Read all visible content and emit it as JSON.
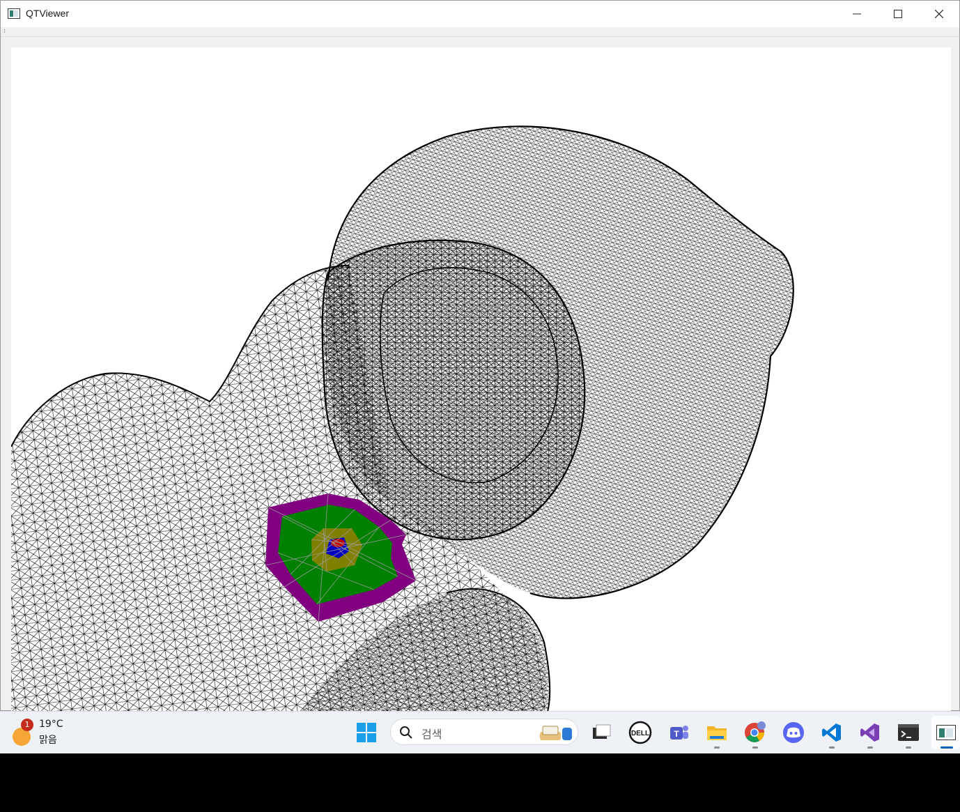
{
  "window": {
    "title": "QTViewer",
    "minimize_symbol": "—",
    "maximize_symbol": "☐",
    "close_symbol": "✕"
  },
  "viewport": {
    "background": "#ffffff",
    "wire_color": "#000000",
    "region_colors": {
      "outer": "#800080",
      "middle": "#008000",
      "inner": "#808000",
      "center_blue": "#0000c0",
      "center_red": "#c00000"
    }
  },
  "taskbar": {
    "weather": {
      "temperature": "19°C",
      "condition": "맑음",
      "badge": "1"
    },
    "search": {
      "placeholder": "검색"
    },
    "apps": [
      {
        "name": "task-view",
        "running": false
      },
      {
        "name": "dell",
        "running": false
      },
      {
        "name": "teams",
        "running": false
      },
      {
        "name": "file-explorer",
        "running": true
      },
      {
        "name": "chrome",
        "running": true
      },
      {
        "name": "discord",
        "running": false
      },
      {
        "name": "vscode",
        "running": true
      },
      {
        "name": "visual-studio",
        "running": true
      },
      {
        "name": "terminal",
        "running": true
      },
      {
        "name": "qtviewer",
        "running": true,
        "active": true
      }
    ]
  }
}
